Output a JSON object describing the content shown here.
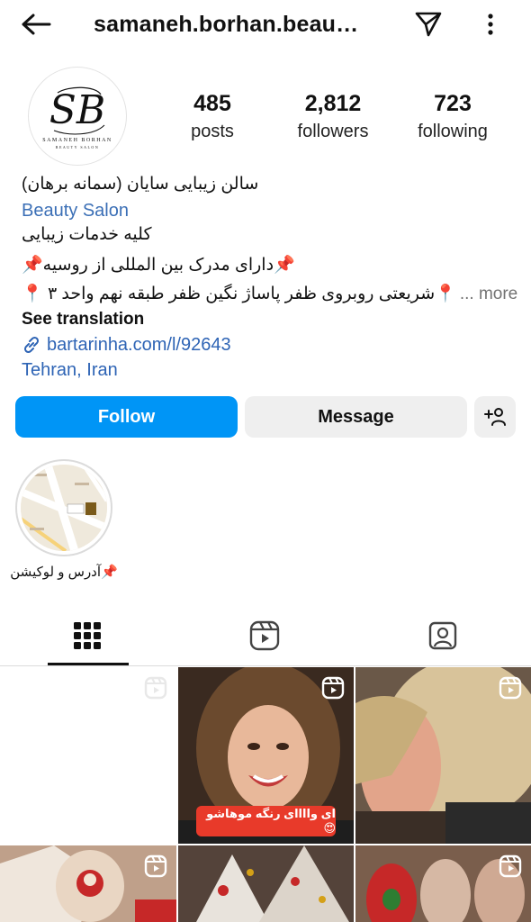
{
  "header": {
    "username": "samaneh.borhan.beau…",
    "icons": [
      "back-arrow-icon",
      "send-icon",
      "more-icon"
    ]
  },
  "profile": {
    "avatar_text_main": "SB",
    "avatar_text_sub": "SAMANEH BORHAN",
    "avatar_text_sub2": "BEAUTY SALON",
    "stats": {
      "posts": {
        "value": "485",
        "label": "posts"
      },
      "followers": {
        "value": "2,812",
        "label": "followers"
      },
      "following": {
        "value": "723",
        "label": "following"
      }
    }
  },
  "bio": {
    "name": "سالن زیبایی سایان (سمانه برهان)",
    "category": "Beauty Salon",
    "line1": "کلیه خدمات زیبایی",
    "line2": "📌دارای مدرک بین المللی از روسیه📌",
    "line3": "📍شریعتی روبروی ظفر پاساژ نگین ظفر طبقه نهم واحد ۳ 📍",
    "more_prefix": "... ",
    "more_label": "more",
    "see_translation": "See translation",
    "link": "bartarinha.com/l/92643",
    "location": "Tehran, Iran"
  },
  "actions": {
    "follow": "Follow",
    "message": "Message"
  },
  "highlights": [
    {
      "label": "📌آدرس و لوکیشن"
    }
  ],
  "post_overlays": {
    "caption_post2": "ای واااای رنگه موهاشو😍"
  },
  "colors": {
    "follow_blue": "#0095f6",
    "link_blue": "#2e64b5",
    "button_gray": "#efefef"
  }
}
